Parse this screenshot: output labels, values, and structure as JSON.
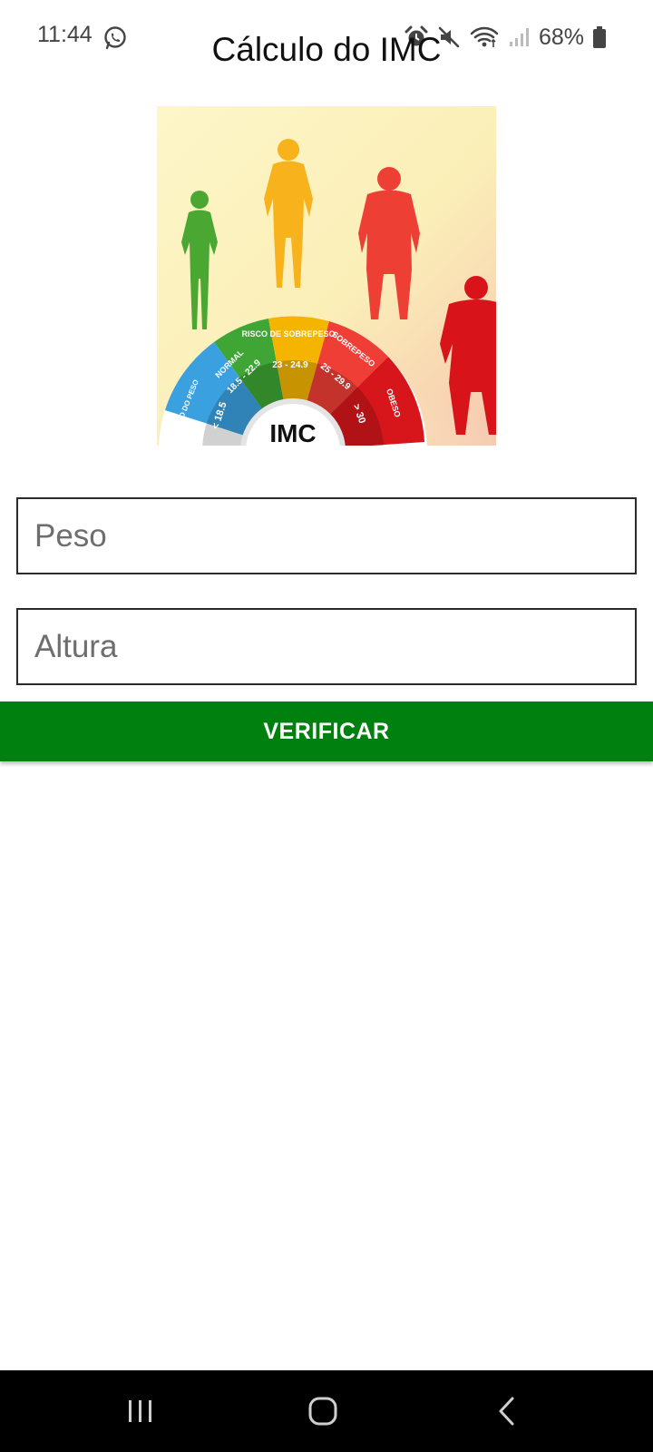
{
  "status_bar": {
    "time": "11:44",
    "battery": "68%",
    "icons": [
      "whatsapp-icon",
      "alarm-icon",
      "mute-icon",
      "wifi-icon",
      "signal-icon",
      "battery-icon"
    ]
  },
  "app": {
    "title": "Cálculo do IMC"
  },
  "illustration": {
    "center_label": "IMC",
    "segments": [
      {
        "label": "ABAIXO DO PESO",
        "range": "< 18.5",
        "color": "#3aa0e0"
      },
      {
        "label": "NORMAL",
        "range": "18.5 - 22.9",
        "color": "#3fa535"
      },
      {
        "label": "RISCO DE SOBREPESO",
        "range": "23 - 24.9",
        "color": "#f4b400"
      },
      {
        "label": "SOBREPESO",
        "range": "25 - 29.9",
        "color": "#ef3e36"
      },
      {
        "label": "OBESO",
        "range": "> 30",
        "color": "#d7161b"
      }
    ]
  },
  "form": {
    "weight_placeholder": "Peso",
    "height_placeholder": "Altura",
    "verify_label": "VERIFICAR"
  },
  "nav_bar": {
    "buttons": [
      "recents-icon",
      "home-icon",
      "back-icon"
    ]
  }
}
